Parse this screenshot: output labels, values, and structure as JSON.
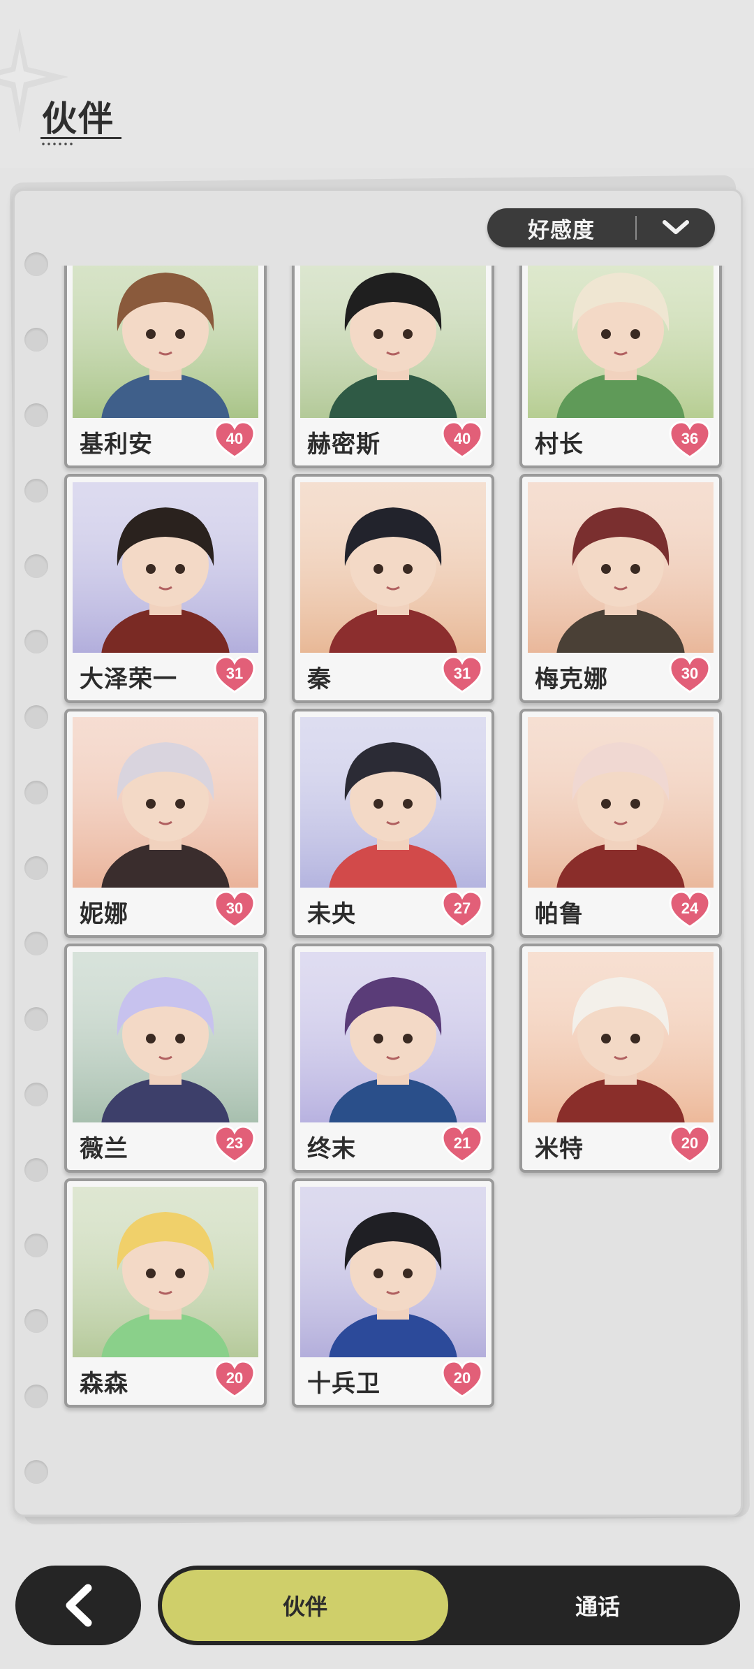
{
  "header": {
    "title": "伙伴"
  },
  "sort": {
    "label": "好感度"
  },
  "companions": [
    {
      "name": "基利安",
      "affinity": "40",
      "bg": "#a9c488",
      "hair": "#8a5a3c",
      "outfit": "#3f5f8a"
    },
    {
      "name": "赫密斯",
      "affinity": "40",
      "bg": "#b3c998",
      "hair": "#1f1f1f",
      "outfit": "#2f5a45"
    },
    {
      "name": "村长",
      "affinity": "36",
      "bg": "#b6cd92",
      "hair": "#efe6d2",
      "outfit": "#5f9a58"
    },
    {
      "name": "大泽荣一",
      "affinity": "31",
      "bg": "#b2aedc",
      "hair": "#2a221e",
      "outfit": "#7a2a24"
    },
    {
      "name": "秦",
      "affinity": "31",
      "bg": "#e8b896",
      "hair": "#22232c",
      "outfit": "#8c2e2e"
    },
    {
      "name": "梅克娜",
      "affinity": "30",
      "bg": "#e9b79a",
      "hair": "#7a2f2f",
      "outfit": "#4a4036"
    },
    {
      "name": "妮娜",
      "affinity": "30",
      "bg": "#eab39a",
      "hair": "#d9d4de",
      "outfit": "#3a2d2d"
    },
    {
      "name": "未央",
      "affinity": "27",
      "bg": "#b4b4df",
      "hair": "#2b2b35",
      "outfit": "#d24a4a"
    },
    {
      "name": "帕鲁",
      "affinity": "24",
      "bg": "#eab89c",
      "hair": "#f0d8d2",
      "outfit": "#8a2d2a"
    },
    {
      "name": "薇兰",
      "affinity": "23",
      "bg": "#a7bfae",
      "hair": "#c7c2ee",
      "outfit": "#3d3f6a"
    },
    {
      "name": "终末",
      "affinity": "21",
      "bg": "#b8b2e0",
      "hair": "#5a3c78",
      "outfit": "#2a4f8a"
    },
    {
      "name": "米特",
      "affinity": "20",
      "bg": "#edb99a",
      "hair": "#f3f0ea",
      "outfit": "#8a2e2a"
    },
    {
      "name": "森森",
      "affinity": "20",
      "bg": "#b5c99a",
      "hair": "#f0d06a",
      "outfit": "#8ad08a"
    },
    {
      "name": "十兵卫",
      "affinity": "20",
      "bg": "#b3aedb",
      "hair": "#1f1f24",
      "outfit": "#2c4a9a"
    }
  ],
  "footer": {
    "back_icon": "chevron-left-icon",
    "tab_companions": "伙伴",
    "tab_call": "通话"
  },
  "colors": {
    "accent": "#cfcf6a",
    "heart": "#e25f78",
    "dark": "#252525"
  }
}
